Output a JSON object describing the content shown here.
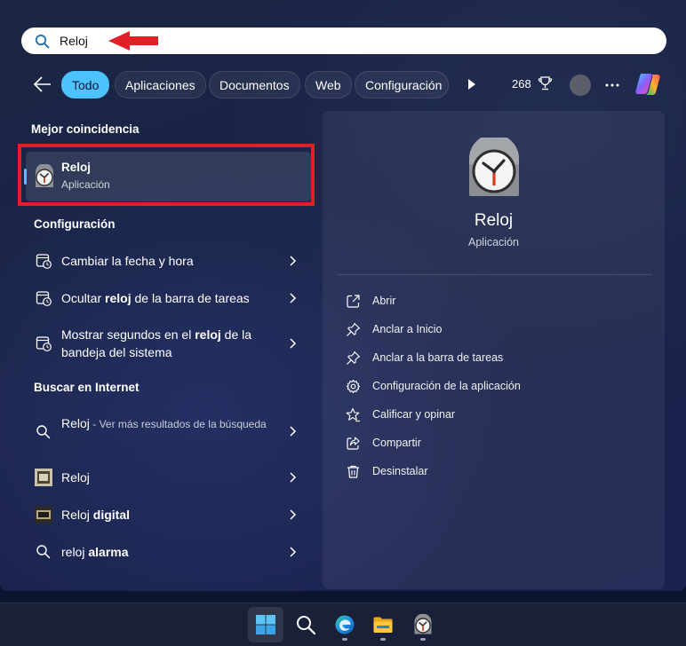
{
  "search": {
    "value": "Reloj",
    "placeholder": ""
  },
  "tabs": [
    {
      "label": "Todo",
      "active": true
    },
    {
      "label": "Aplicaciones",
      "active": false
    },
    {
      "label": "Documentos",
      "active": false
    },
    {
      "label": "Web",
      "active": false
    },
    {
      "label": "Configuración",
      "active": false
    }
  ],
  "toolbar": {
    "points": "268"
  },
  "best_match": {
    "title": "Mejor coincidencia",
    "name": "Reloj",
    "type": "Aplicación"
  },
  "settings": {
    "title": "Configuración",
    "items": [
      {
        "parts": [
          {
            "text": "Cambiar la fecha y hora",
            "bold": false
          }
        ]
      },
      {
        "parts": [
          {
            "text": "Ocultar ",
            "bold": false
          },
          {
            "text": "reloj",
            "bold": true
          },
          {
            "text": " de la barra de tareas",
            "bold": false
          }
        ]
      },
      {
        "parts": [
          {
            "text": "Mostrar segundos en el ",
            "bold": false
          },
          {
            "text": "reloj",
            "bold": true
          },
          {
            "text": " de la bandeja del sistema",
            "bold": false
          }
        ]
      }
    ]
  },
  "web": {
    "title": "Buscar en Internet",
    "items": [
      {
        "parts": [
          {
            "text": "Reloj",
            "bold": false
          }
        ],
        "sub": " - Ver más resultados de la búsqueda"
      },
      {
        "parts": [
          {
            "text": "Reloj",
            "bold": false
          }
        ]
      },
      {
        "parts": [
          {
            "text": "Reloj ",
            "bold": false
          },
          {
            "text": "digital",
            "bold": true
          }
        ]
      },
      {
        "parts": [
          {
            "text": "reloj ",
            "bold": false
          },
          {
            "text": "alarma",
            "bold": true
          }
        ]
      }
    ]
  },
  "details": {
    "name": "Reloj",
    "type": "Aplicación",
    "actions": [
      {
        "label": "Abrir",
        "icon": "open-icon"
      },
      {
        "label": "Anclar a Inicio",
        "icon": "pin-icon"
      },
      {
        "label": "Anclar a la barra de tareas",
        "icon": "pin-icon"
      },
      {
        "label": "Configuración de la aplicación",
        "icon": "gear-icon"
      },
      {
        "label": "Calificar y opinar",
        "icon": "star-icon"
      },
      {
        "label": "Compartir",
        "icon": "share-icon"
      },
      {
        "label": "Desinstalar",
        "icon": "trash-icon"
      }
    ]
  },
  "taskbar": {
    "items": [
      {
        "icon": "windows-start-icon",
        "active": true
      },
      {
        "icon": "search-icon",
        "active": false
      },
      {
        "icon": "edge-icon",
        "active": false
      },
      {
        "icon": "file-explorer-icon",
        "active": false
      },
      {
        "icon": "clock-app-icon",
        "active": false
      }
    ]
  },
  "colors": {
    "accent": "#4cc2ff",
    "highlight": "#e01f26"
  }
}
